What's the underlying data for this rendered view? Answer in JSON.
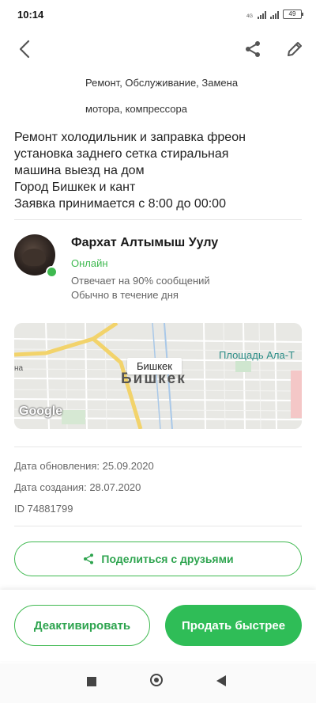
{
  "status_bar": {
    "time": "10:14",
    "signal_label_1": "4G",
    "battery": "49"
  },
  "toolbar": {
    "back_icon": "chevron-left-icon",
    "share_icon": "share-icon",
    "edit_icon": "pencil-icon"
  },
  "listing": {
    "category_line1": "Ремонт, Обслуживание, Замена",
    "category_line2": "мотора, компрессора",
    "description_lines": [
      "Ремонт холодильник и заправка фреон",
      "установка заднего сетка стиральная",
      "машина выезд на дом",
      "Город Бишкек и кант",
      "Заявка принимается с 8:00 до 00:00"
    ]
  },
  "seller": {
    "name": "Фархат Алтымыш Уулу",
    "status": "Онлайн",
    "response_rate": "Отвечает на 90% сообщений",
    "response_time": "Обычно в течение дня"
  },
  "map": {
    "city_label": "Бишкек",
    "square_label": "Площадь Ала-Т",
    "partial_label": "на",
    "big_city_text": "Бишкек",
    "provider": "Google"
  },
  "meta": {
    "updated": "Дата обновления: 25.09.2020",
    "created": "Дата создания: 28.07.2020",
    "id": "ID 74881799"
  },
  "actions": {
    "share_friends": "Поделиться с друзьями",
    "deactivate": "Деактивировать",
    "sell_faster": "Продать быстрее"
  },
  "colors": {
    "accent": "#2fbd57",
    "online": "#3fb950"
  }
}
